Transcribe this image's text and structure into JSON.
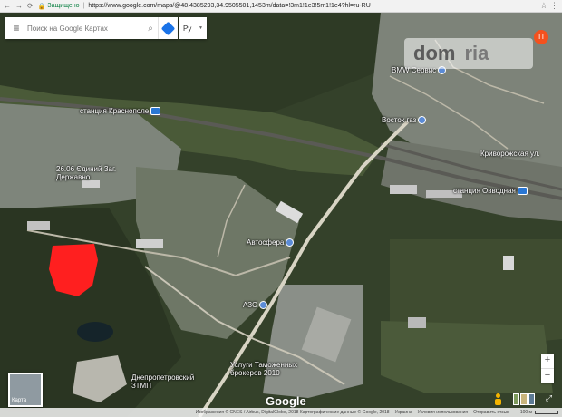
{
  "browser": {
    "back_icon": "back-arrow-icon",
    "forward_icon": "forward-arrow-icon",
    "reload_icon": "reload-icon",
    "secure_label": "Защищено",
    "url": "https://www.google.com/maps/@48.4385293,34.9505501,1453m/data=!3m1!1e3!5m1!1e4?hl=ru-RU"
  },
  "search": {
    "placeholder": "Поиск на Google Картах",
    "language": "Ру"
  },
  "watermark": {
    "text_dom": "dom",
    "text_ria": "ria"
  },
  "avatar": {
    "letter": "П"
  },
  "labels": {
    "station_krasnopolye": "станция Краснополе",
    "bmw": "BMW Сервис",
    "vostok_gaz": "Восток газ",
    "krivorozhskaya": "Криворожская ул.",
    "zhilmassiv": "26.06 Єдиний Заг. Державно",
    "station_ovodnaya": "станция Овводная",
    "avtosfera": "Автосфера",
    "azs": "АЗС",
    "customs": "Услуги Таможенных брокеров 2010",
    "dnepr_zavod": "Днепропетровский ЗТМП",
    "thumb_label": "Карта",
    "google": "Google"
  },
  "footer": {
    "imagery": "Изображения © CNES / Airbus, DigitalGlobe, 2018 Картографические данные © Google, 2018",
    "country": "Украина",
    "terms": "Условия использования",
    "feedback": "Отправить отзыв",
    "scale": "100 м"
  },
  "colors": {
    "forest": "#2f3a24",
    "field": "#6b7b50",
    "urban": "#8a8f86",
    "road": "#d9d6c8",
    "water": "#1c2a30",
    "plot": "#ff1f1f"
  }
}
